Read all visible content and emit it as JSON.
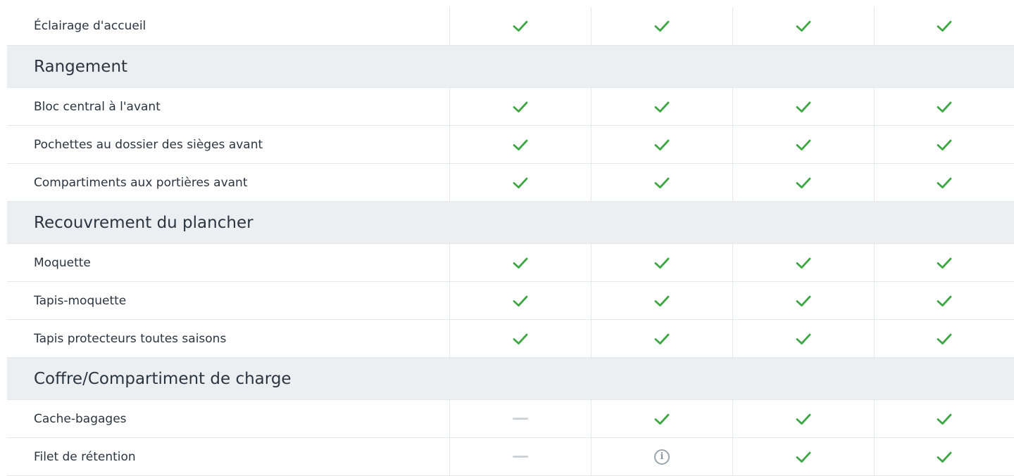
{
  "icon_names": {
    "yes": "check-icon",
    "no": "dash-icon",
    "info": "info-icon"
  },
  "colors": {
    "check": "#3fa644",
    "dash": "#cdd3d7",
    "section_bg": "#eceff1",
    "info": "#9aa5ad"
  },
  "rows": [
    {
      "type": "feature",
      "label": "Éclairage d'accueil",
      "values": [
        "yes",
        "yes",
        "yes",
        "yes"
      ]
    },
    {
      "type": "section",
      "label": "Rangement"
    },
    {
      "type": "feature",
      "label": "Bloc central à l'avant",
      "values": [
        "yes",
        "yes",
        "yes",
        "yes"
      ]
    },
    {
      "type": "feature",
      "label": "Pochettes au dossier des sièges avant",
      "values": [
        "yes",
        "yes",
        "yes",
        "yes"
      ]
    },
    {
      "type": "feature",
      "label": "Compartiments aux portières avant",
      "values": [
        "yes",
        "yes",
        "yes",
        "yes"
      ]
    },
    {
      "type": "section",
      "label": "Recouvrement du plancher"
    },
    {
      "type": "feature",
      "label": "Moquette",
      "values": [
        "yes",
        "yes",
        "yes",
        "yes"
      ]
    },
    {
      "type": "feature",
      "label": "Tapis-moquette",
      "values": [
        "yes",
        "yes",
        "yes",
        "yes"
      ]
    },
    {
      "type": "feature",
      "label": "Tapis protecteurs toutes saisons",
      "values": [
        "yes",
        "yes",
        "yes",
        "yes"
      ]
    },
    {
      "type": "section",
      "label": "Coffre/Compartiment de charge"
    },
    {
      "type": "feature",
      "label": "Cache-bagages",
      "values": [
        "no",
        "yes",
        "yes",
        "yes"
      ]
    },
    {
      "type": "feature",
      "label": "Filet de rétention",
      "values": [
        "no",
        "info",
        "yes",
        "yes"
      ]
    }
  ]
}
